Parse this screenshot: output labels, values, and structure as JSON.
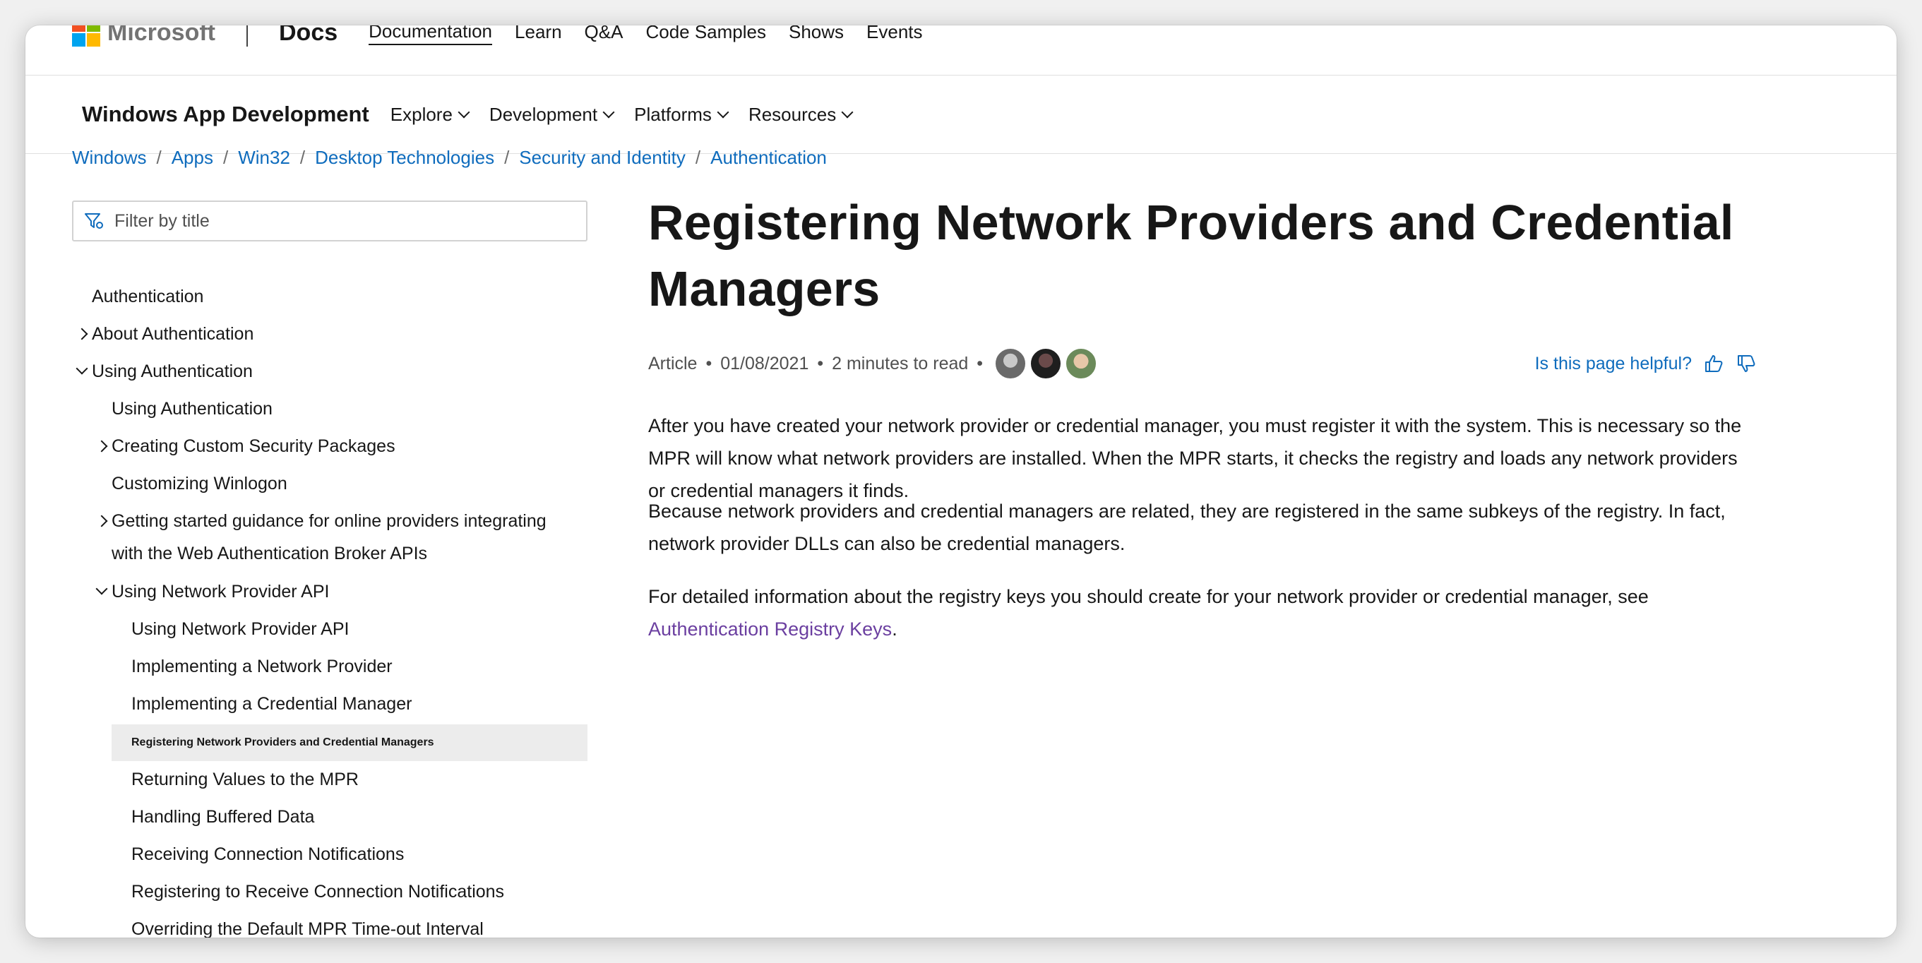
{
  "topnav": {
    "brand": "Microsoft",
    "product": "Docs",
    "links": [
      "Documentation",
      "Learn",
      "Q&A",
      "Code Samples",
      "Shows",
      "Events"
    ],
    "logo_colors": [
      "#f25022",
      "#7fba00",
      "#00a4ef",
      "#ffb900"
    ]
  },
  "subnav": {
    "title": "Windows App Development",
    "items": [
      "Explore",
      "Development",
      "Platforms",
      "Resources"
    ]
  },
  "breadcrumb": [
    "Windows",
    "Apps",
    "Win32",
    "Desktop Technologies",
    "Security and Identity",
    "Authentication"
  ],
  "sidebar": {
    "filter_placeholder": "Filter by title",
    "toc": [
      {
        "label": "Authentication",
        "level": 0,
        "twisty": "none"
      },
      {
        "label": "About Authentication",
        "level": 0,
        "twisty": "right"
      },
      {
        "label": "Using Authentication",
        "level": 0,
        "twisty": "down"
      },
      {
        "label": "Using Authentication",
        "level": 1,
        "twisty": "none"
      },
      {
        "label": "Creating Custom Security Packages",
        "level": 1,
        "twisty": "right"
      },
      {
        "label": "Customizing Winlogon",
        "level": 1,
        "twisty": "none"
      },
      {
        "label": "Getting started guidance for online providers integrating",
        "label2": "with the Web Authentication Broker APIs",
        "level": 1,
        "twisty": "right"
      },
      {
        "label": "Using Network Provider API",
        "level": 1,
        "twisty": "down"
      },
      {
        "label": "Using Network Provider API",
        "level": 2,
        "twisty": "none"
      },
      {
        "label": "Implementing a Network Provider",
        "level": 2,
        "twisty": "none"
      },
      {
        "label": "Implementing a Credential Manager",
        "level": 2,
        "twisty": "none"
      },
      {
        "label": "Registering Network Providers and Credential Managers",
        "level": 2,
        "twisty": "none",
        "active": true
      },
      {
        "label": "Returning Values to the MPR",
        "level": 2,
        "twisty": "none"
      },
      {
        "label": "Handling Buffered Data",
        "level": 2,
        "twisty": "none"
      },
      {
        "label": "Receiving Connection Notifications",
        "level": 2,
        "twisty": "none"
      },
      {
        "label": "Registering to Receive Connection Notifications",
        "level": 2,
        "twisty": "none"
      },
      {
        "label": "Overriding the Default MPR Time-out Interval",
        "level": 2,
        "twisty": "none"
      }
    ]
  },
  "article": {
    "title": "Registering Network Providers and Credential Managers",
    "meta": {
      "type": "Article",
      "date": "01/08/2021",
      "read_time": "2 minutes to read"
    },
    "helpful": "Is this page helpful?",
    "paragraphs": [
      "After you have created your network provider or credential manager, you must register it with the system. This is necessary so the MPR will know what network providers are installed. When the MPR starts, it checks the registry and loads any network providers or credential managers it finds.",
      "Because network providers and credential managers are related, they are registered in the same subkeys of the registry. In fact, network provider DLLs can also be credential managers."
    ],
    "para3_prefix": "For detailed information about the registry keys you should create for your network provider or credential manager, see",
    "para3_link": "Authentication Registry Keys",
    "para3_suffix": "."
  },
  "colors": {
    "link": "#0f6cbd",
    "visited_link": "#6b3fa0",
    "active_toc_bg": "#ececec"
  }
}
